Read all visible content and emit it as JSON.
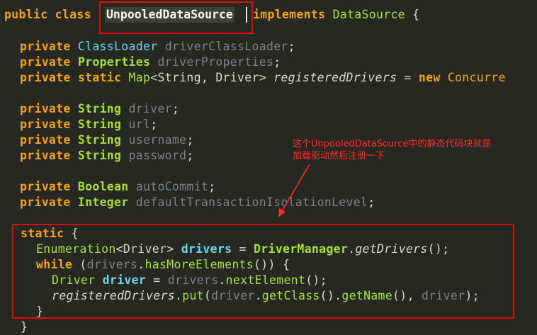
{
  "code": {
    "l1": {
      "kw1": "public",
      "kw2": "class",
      "name": "UnpooledDataSource",
      "kw3": "implements",
      "iface": "DataSource",
      "brace": " {"
    },
    "l2": {
      "kw": "private",
      "type": "ClassLoader",
      "field": "driverClassLoader",
      "end": ";"
    },
    "l3": {
      "kw": "private",
      "type": "Properties",
      "field": "driverProperties",
      "end": ";"
    },
    "l4": {
      "kw": "private",
      "kw2": "static",
      "type": "Map",
      "generic": "<String, Driver>",
      "field": "registeredDrivers",
      "eq": " = ",
      "new": "new",
      "impl": "Concurre"
    },
    "l5": {
      "kw": "private",
      "type": "String",
      "field": "driver",
      "end": ";"
    },
    "l6": {
      "kw": "private",
      "type": "String",
      "field": "url",
      "end": ";"
    },
    "l7": {
      "kw": "private",
      "type": "String",
      "field": "username",
      "end": ";"
    },
    "l8": {
      "kw": "private",
      "type": "String",
      "field": "password",
      "end": ";"
    },
    "l9": {
      "kw": "private",
      "type": "Boolean",
      "field": "autoCommit",
      "end": ";"
    },
    "l10": {
      "kw": "private",
      "type": "Integer",
      "field": "defaultTransactionIsolationLevel",
      "end": ";"
    },
    "l11": {
      "kw": "static",
      "brace": " {"
    },
    "l12": {
      "type": "Enumeration",
      "generic": "<Driver>",
      "var": "drivers",
      "eq": " = ",
      "cls": "DriverManager",
      "dot": ".",
      "m": "getDrivers",
      "end": "();"
    },
    "l13": {
      "kw": "while",
      "p1": " (",
      "var": "drivers",
      "dot": ".",
      "m": "hasMoreElements",
      "end": "()) {"
    },
    "l14": {
      "type": "Driver",
      "var": "driver",
      "eq": " = ",
      "var2": "drivers",
      "dot": ".",
      "m": "nextElement",
      "end": "();"
    },
    "l15": {
      "f": "registeredDrivers",
      "dot": ".",
      "m": "put",
      "p1": "(",
      "v1": "driver",
      "dot2": ".",
      "m2": "getClass",
      "p2": "().",
      "m3": "getName",
      "p3": "(), ",
      "v2": "driver",
      "end": ");"
    },
    "l16": {
      "brace": "}"
    },
    "l17": {
      "brace": "}"
    }
  },
  "annotation": {
    "line1": "这个UnpooledDataSource中的静态代码块就是",
    "line2": "加载驱动然后注册一下"
  },
  "colors": {
    "background": "#272822",
    "highlight_box": "#e10a0a",
    "annotation": "#ff2a2a"
  }
}
